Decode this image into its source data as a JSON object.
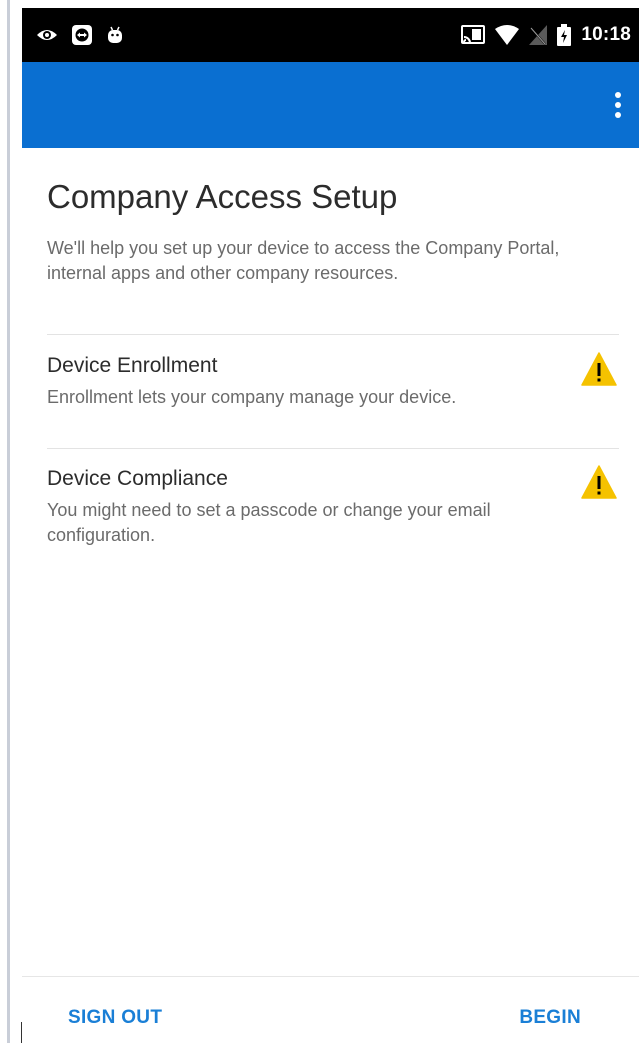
{
  "status_bar": {
    "time": "10:18",
    "left_icons": [
      "eye-icon",
      "teamviewer-icon",
      "android-icon"
    ],
    "right_icons": [
      "cast-icon",
      "wifi-icon",
      "no-signal-icon",
      "battery-icon"
    ]
  },
  "app_bar": {
    "color": "#0a6fd1",
    "menu_icon": "more-vert-icon"
  },
  "main": {
    "title": "Company Access Setup",
    "subtitle": "We'll help you set up your device to access the Company Portal, internal apps and other company resources.",
    "items": [
      {
        "title": "Device Enrollment",
        "description": "Enrollment lets your company manage your device.",
        "status_icon": "warning-icon"
      },
      {
        "title": "Device Compliance",
        "description": "You might need to set a passcode or change your email configuration.",
        "status_icon": "warning-icon"
      }
    ]
  },
  "footer": {
    "sign_out": "SIGN OUT",
    "begin": "BEGIN"
  },
  "colors": {
    "accent": "#1a7fd6",
    "warning": "#f5c200"
  }
}
